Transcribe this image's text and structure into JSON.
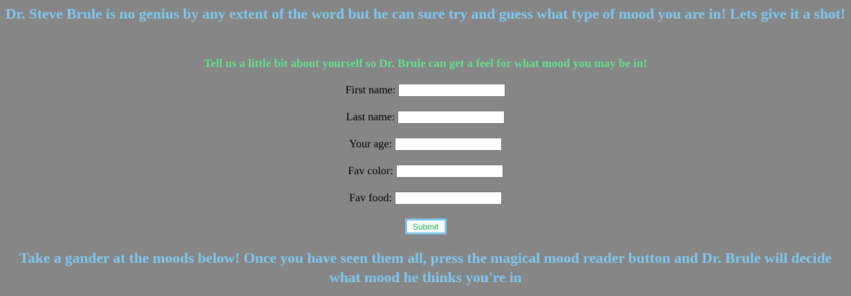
{
  "header": {
    "title": "Dr. Steve Brule is no genius by any extent of the word but he can sure try and guess what type of mood you are in! Lets give it a shot!",
    "subtitle": "Tell us a little bit about yourself so Dr. Brule can get a feel for what mood you may be in!"
  },
  "form": {
    "fields": [
      {
        "label": "First name:",
        "value": ""
      },
      {
        "label": "Last name:",
        "value": ""
      },
      {
        "label": "Your age:",
        "value": ""
      },
      {
        "label": "Fav color:",
        "value": ""
      },
      {
        "label": "Fav food:",
        "value": ""
      }
    ],
    "submit_label": "Submit"
  },
  "footer": {
    "text": "Take a gander at the moods below! Once you have seen them all, press the magical mood reader button and Dr. Brule will decide what mood he thinks you're in"
  },
  "colors": {
    "background": "#868686",
    "heading": "#7ec8f0",
    "subheading": "#66e08a",
    "submit_text": "#11a84a"
  }
}
